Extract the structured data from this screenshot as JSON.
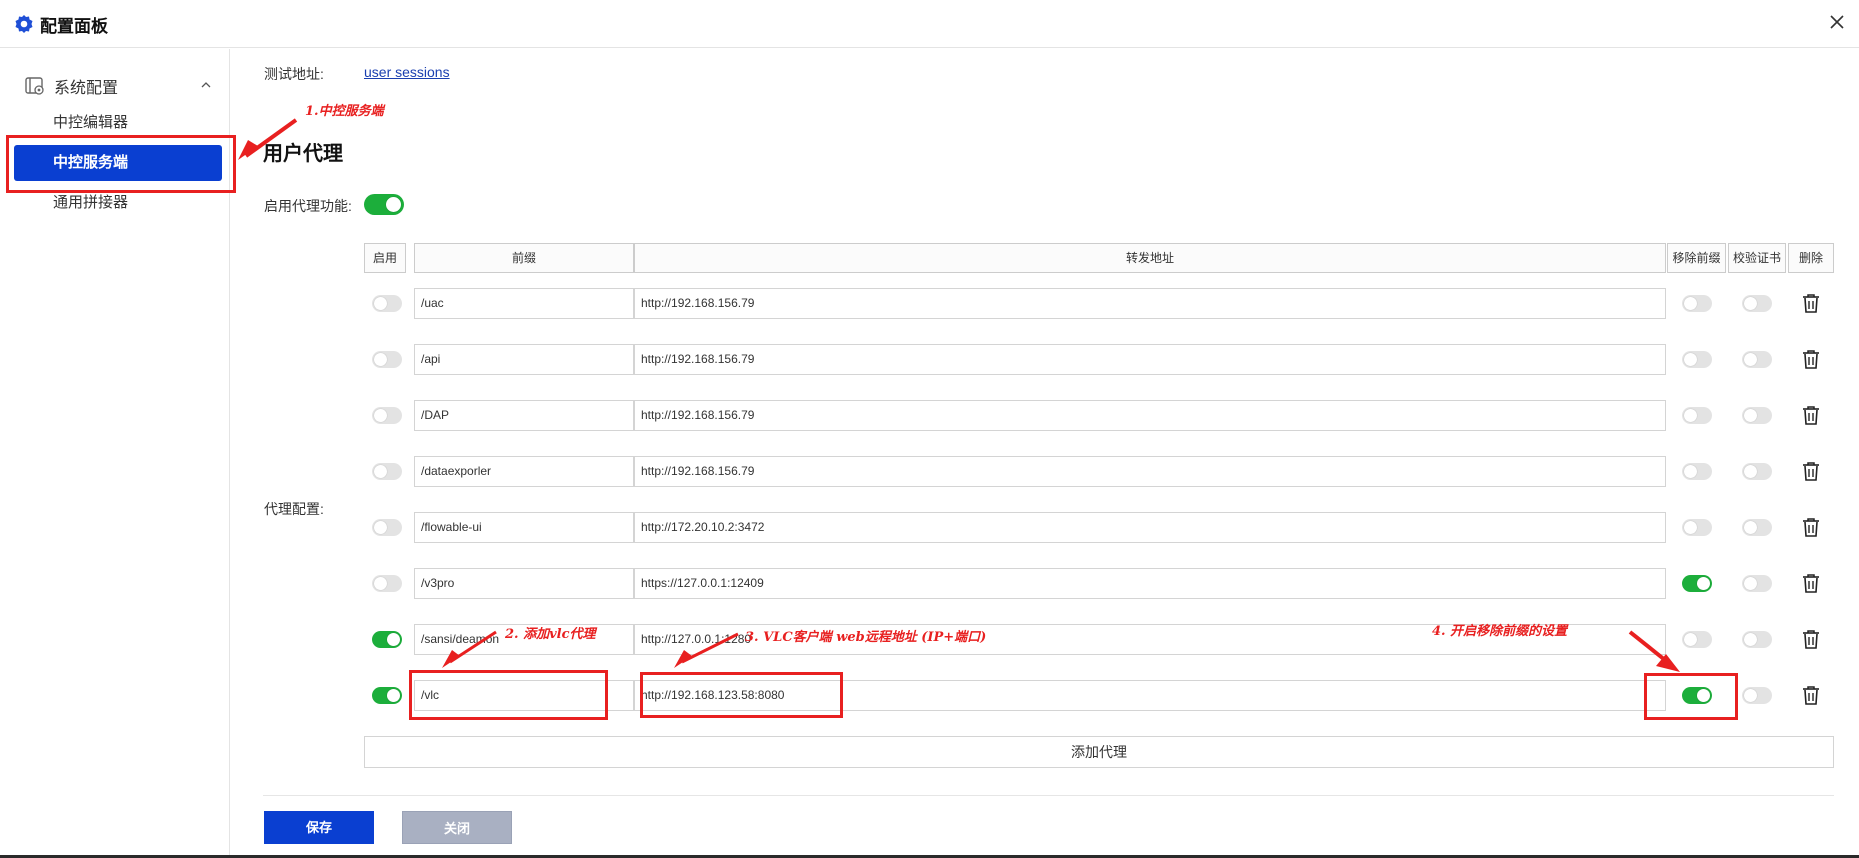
{
  "window": {
    "title": "配置面板"
  },
  "sidebar": {
    "group_label": "系统配置",
    "items": [
      {
        "label": "中控编辑器"
      },
      {
        "label": "中控服务端"
      },
      {
        "label": "通用拼接器"
      }
    ]
  },
  "main": {
    "test_address_label": "测试地址:",
    "test_address_link": "user sessions",
    "section_title": "用户代理",
    "enable_proxy_label": "启用代理功能:",
    "enable_proxy_on": true,
    "proxy_config_label": "代理配置:",
    "table_headers": {
      "enabled": "启用",
      "prefix": "前缀",
      "forward": "转发地址",
      "remove_prefix": "移除前缀",
      "verify_cert": "校验证书",
      "delete": "删除"
    },
    "rows": [
      {
        "enabled": false,
        "prefix": "/uac",
        "forward": "http://192.168.156.79",
        "remove_prefix": false,
        "verify_cert": false
      },
      {
        "enabled": false,
        "prefix": "/api",
        "forward": "http://192.168.156.79",
        "remove_prefix": false,
        "verify_cert": false
      },
      {
        "enabled": false,
        "prefix": "/DAP",
        "forward": "http://192.168.156.79",
        "remove_prefix": false,
        "verify_cert": false
      },
      {
        "enabled": false,
        "prefix": "/dataexporler",
        "forward": "http://192.168.156.79",
        "remove_prefix": false,
        "verify_cert": false
      },
      {
        "enabled": false,
        "prefix": "/flowable-ui",
        "forward": "http://172.20.10.2:3472",
        "remove_prefix": false,
        "verify_cert": false
      },
      {
        "enabled": false,
        "prefix": "/v3pro",
        "forward": "https://127.0.0.1:12409",
        "remove_prefix": true,
        "verify_cert": false
      },
      {
        "enabled": true,
        "prefix": "/sansi/deamon",
        "forward": "http://127.0.0.1:1280",
        "remove_prefix": false,
        "verify_cert": false
      },
      {
        "enabled": true,
        "prefix": "/vlc",
        "forward": "http://192.168.123.58:8080",
        "remove_prefix": true,
        "verify_cert": false
      }
    ],
    "add_proxy_label": "添加代理",
    "save_label": "保存",
    "close_label": "关闭"
  },
  "annotations": {
    "a1": "1.中控服务端",
    "a2": "2. 添加vlc代理",
    "a3": "3. VLC客户端 web远程地址 (IP+端口)",
    "a4": "4. 开启移除前缀的设置"
  },
  "colors": {
    "primary": "#0a3fd1",
    "toggle_on": "#1cae3b",
    "annotation": "#e82020"
  }
}
